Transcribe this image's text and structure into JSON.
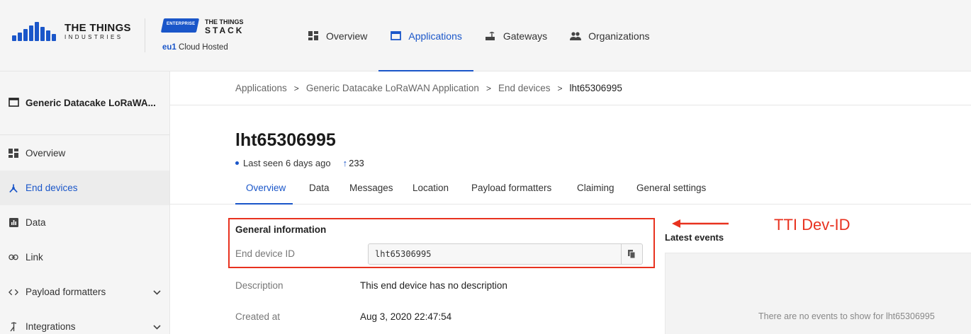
{
  "brand": {
    "company_line1": "THE THINGS",
    "company_line2": "INDUSTRIES",
    "enterprise_badge": "ENTERPRISE",
    "stack_line1": "THE THINGS",
    "stack_line2": "STACK",
    "region": "eu1",
    "hosting": "Cloud Hosted",
    "accent": "#1a56c9"
  },
  "topnav": {
    "items": [
      {
        "label": "Overview",
        "icon": "dashboard-icon"
      },
      {
        "label": "Applications",
        "icon": "window-icon",
        "active": true
      },
      {
        "label": "Gateways",
        "icon": "router-icon"
      },
      {
        "label": "Organizations",
        "icon": "people-icon"
      }
    ]
  },
  "sidebar": {
    "app_name": "Generic Datacake LoRaWA...",
    "items": [
      {
        "label": "Overview",
        "icon": "dashboard-icon"
      },
      {
        "label": "End devices",
        "icon": "device-hub-icon",
        "active": true
      },
      {
        "label": "Data",
        "icon": "bar-chart-icon"
      },
      {
        "label": "Link",
        "icon": "link-icon"
      },
      {
        "label": "Payload formatters",
        "icon": "code-icon",
        "expandable": true
      },
      {
        "label": "Integrations",
        "icon": "integration-icon",
        "expandable": true
      }
    ]
  },
  "breadcrumb": {
    "items": [
      "Applications",
      "Generic Datacake LoRaWAN Application",
      "End devices",
      "lht65306995"
    ],
    "separator": ">"
  },
  "device": {
    "title": "lht65306995",
    "last_seen": "Last seen 6 days ago",
    "uplink_count": "233"
  },
  "tabs": {
    "items": [
      "Overview",
      "Data",
      "Messages",
      "Location",
      "Payload formatters",
      "Claiming",
      "General settings"
    ],
    "active": "Overview"
  },
  "general_info": {
    "heading": "General information",
    "end_device_id_label": "End device ID",
    "end_device_id_value": "lht65306995",
    "description_label": "Description",
    "description_value": "This end device has no description",
    "created_label": "Created at",
    "created_value": "Aug 3, 2020 22:47:54"
  },
  "events": {
    "heading": "Latest events",
    "empty_text": "There are no events to show for lht65306995"
  },
  "annotation": {
    "text": "TTI Dev-ID",
    "color": "#e8321f"
  }
}
